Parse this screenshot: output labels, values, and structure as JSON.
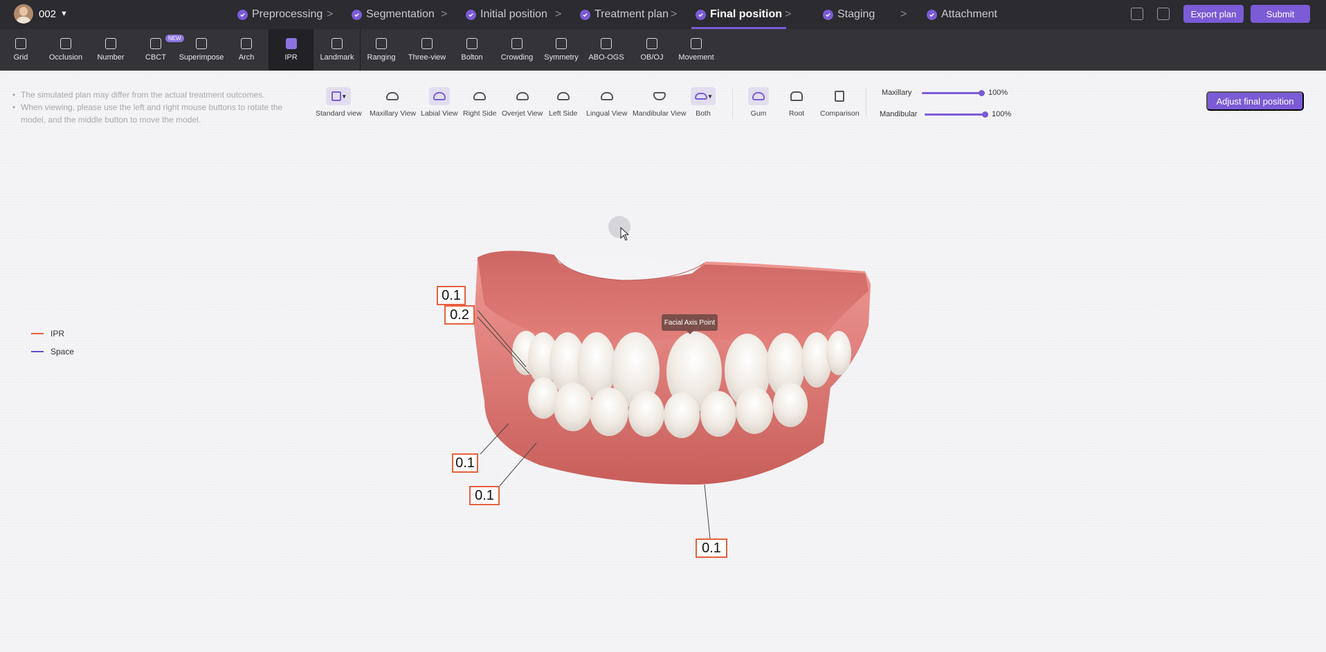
{
  "patient": {
    "id": "002"
  },
  "steps": [
    {
      "label": "Preprocessing",
      "done": true
    },
    {
      "label": "Segmentation",
      "done": true
    },
    {
      "label": "Initial position",
      "done": true
    },
    {
      "label": "Treatment plan",
      "done": true
    },
    {
      "label": "Final position",
      "done": true,
      "active": true
    },
    {
      "label": "Staging",
      "done": true
    },
    {
      "label": "Attachment",
      "done": true
    }
  ],
  "actions": {
    "export": "Export plan",
    "submit": "Submit"
  },
  "tools": [
    {
      "label": "Grid"
    },
    {
      "label": "Occlusion"
    },
    {
      "label": "Number"
    },
    {
      "label": "CBCT",
      "badge": "NEW"
    },
    {
      "label": "Superimpose"
    },
    {
      "label": "Arch"
    },
    {
      "label": "IPR",
      "active": true
    },
    {
      "label": "Landmark"
    },
    {
      "label": "Ranging"
    },
    {
      "label": "Three-view"
    },
    {
      "label": "Bolton"
    },
    {
      "label": "Crowding"
    },
    {
      "label": "Symmetry"
    },
    {
      "label": "ABO-OGS"
    },
    {
      "label": "OB/OJ"
    },
    {
      "label": "Movement"
    }
  ],
  "notes": [
    "The simulated plan may differ from the actual treatment outcomes.",
    "When viewing, please use the left and right mouse buttons to rotate the model, and the middle button to move the model."
  ],
  "views": [
    {
      "label": "Standard view"
    },
    {
      "label": "Maxillary View"
    },
    {
      "label": "Labial View",
      "selected": true
    },
    {
      "label": "Right Side"
    },
    {
      "label": "Overjet View"
    },
    {
      "label": "Left Side"
    },
    {
      "label": "Lingual View"
    },
    {
      "label": "Mandibular View"
    },
    {
      "label": "Both"
    },
    {
      "label": "Gum",
      "selected": true
    },
    {
      "label": "Root"
    },
    {
      "label": "Comparison"
    }
  ],
  "opacity": {
    "maxillary": {
      "label": "Maxillary",
      "value": "100%",
      "level": 1.0
    },
    "mandibular": {
      "label": "Mandibular",
      "value": "100%",
      "level": 1.0
    }
  },
  "adjust_button": "Adjust final position",
  "legend": [
    {
      "label": "IPR",
      "color": "#e8603c"
    },
    {
      "label": "Space",
      "color": "#5b4bd6"
    }
  ],
  "tooltip": "Facial Axis Point",
  "ipr_labels": [
    "0.1",
    "0.2",
    "0.1",
    "0.1",
    "0.1"
  ],
  "colors": {
    "accent": "#7b5bd6",
    "ipr": "#e8603c",
    "space": "#5b4bd6"
  }
}
